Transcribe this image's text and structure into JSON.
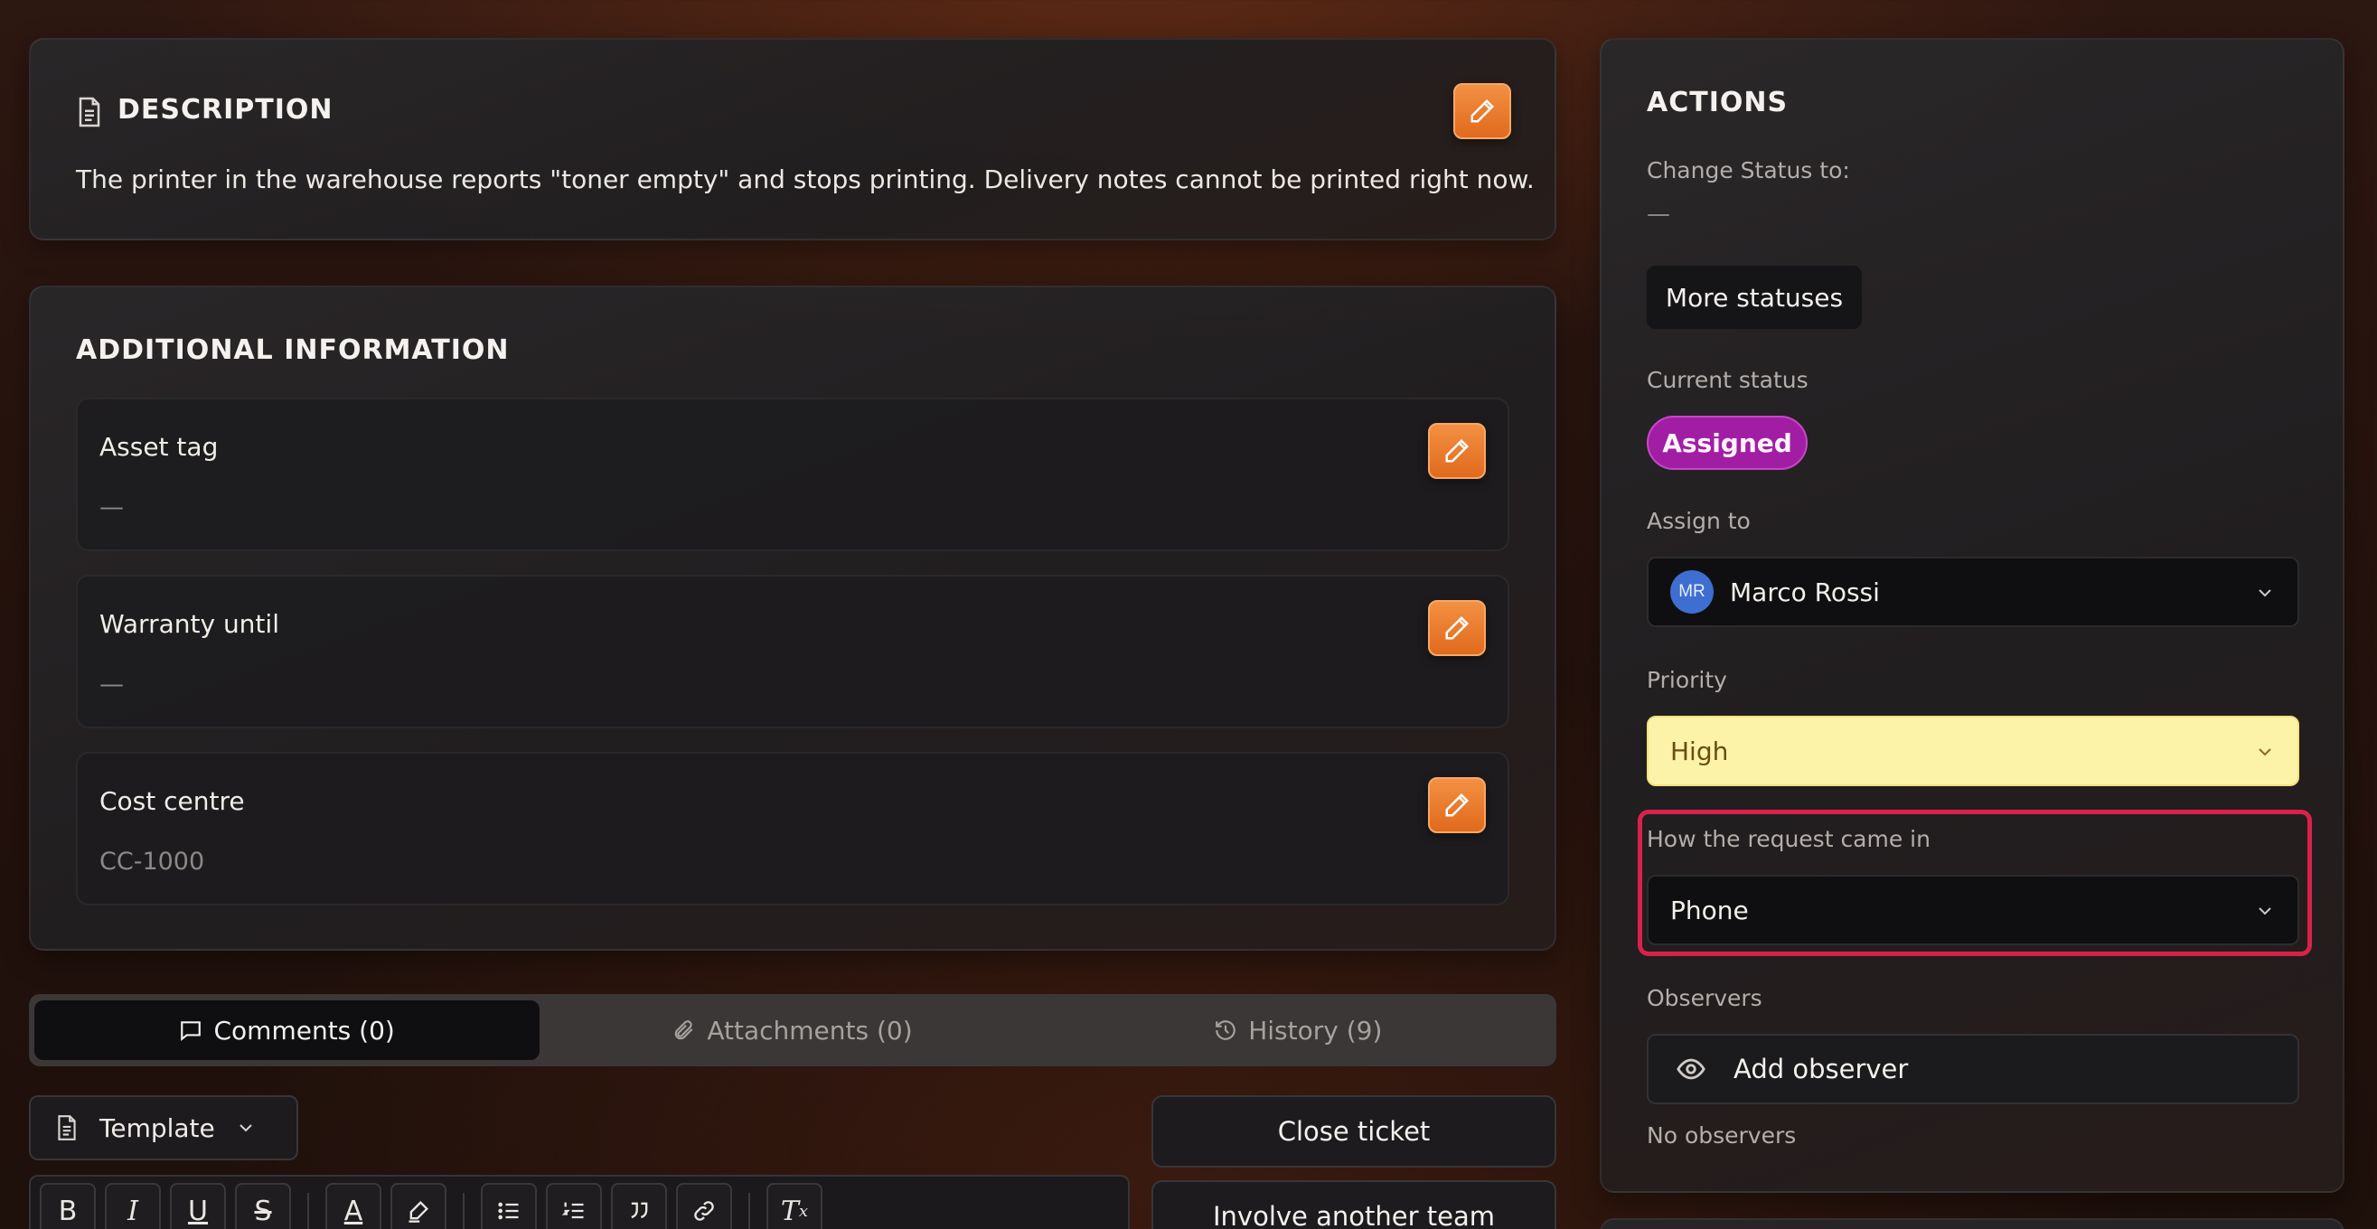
{
  "description": {
    "title": "DESCRIPTION",
    "text": "The printer in the warehouse reports \"toner empty\" and stops printing. Delivery notes cannot be printed right now."
  },
  "additional": {
    "title": "ADDITIONAL INFORMATION",
    "fields": [
      {
        "label": "Asset tag",
        "value": "—"
      },
      {
        "label": "Warranty until",
        "value": "—"
      },
      {
        "label": "Cost centre",
        "value": "CC-1000"
      }
    ]
  },
  "tabs": [
    {
      "label": "Comments (0)",
      "icon": "comment-icon",
      "active": true
    },
    {
      "label": "Attachments (0)",
      "icon": "paperclip-icon",
      "active": false
    },
    {
      "label": "History (9)",
      "icon": "history-icon",
      "active": false
    }
  ],
  "composer": {
    "template_label": "Template",
    "toolbar": [
      "B",
      "I",
      "U",
      "S",
      "A",
      "highlight",
      "bullet-list",
      "numbered-list",
      "quote",
      "link",
      "Tx"
    ]
  },
  "buttons": {
    "close_ticket": "Close ticket",
    "involve_team": "Involve another team"
  },
  "actions": {
    "title": "ACTIONS",
    "change_status_label": "Change Status to:",
    "change_status_value": "—",
    "more_statuses": "More statuses",
    "current_status_label": "Current status",
    "current_status": "Assigned",
    "assign_label": "Assign to",
    "assignee_initials": "MR",
    "assignee": "Marco Rossi",
    "priority_label": "Priority",
    "priority": "High",
    "channel_label": "How the request came in",
    "channel": "Phone",
    "observers_label": "Observers",
    "add_observer": "Add observer",
    "no_observers": "No observers"
  },
  "colors": {
    "accent_orange": "#e8782a",
    "status_assigned": "#a11ea4",
    "priority_high_bg": "#fdf3a8",
    "highlight_border": "#d9224a"
  }
}
